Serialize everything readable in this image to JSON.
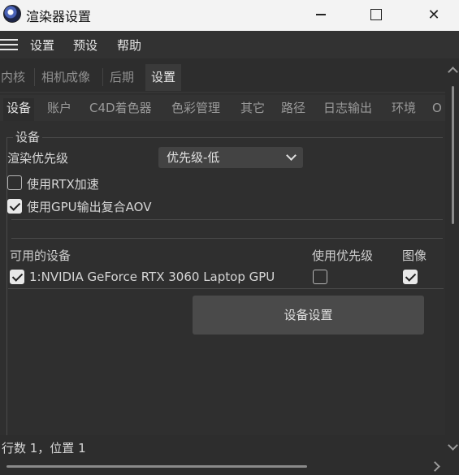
{
  "window": {
    "title": "渲染器设置"
  },
  "menu": {
    "items": [
      "设置",
      "预设",
      "帮助"
    ]
  },
  "top_tabs": [
    "内核",
    "相机成像",
    "后期",
    "设置"
  ],
  "sub_tabs": [
    "设备",
    "账户",
    "C4D着色器",
    "色彩管理",
    "其它",
    "路径",
    "日志输出",
    "环境",
    "O"
  ],
  "device_group": {
    "title": "设备",
    "priority_label": "渲染优先级",
    "priority_value": "优先级-低",
    "rtx_label": "使用RTX加速",
    "rtx_checked": false,
    "gpu_aov_label": "使用GPU输出复合AOV",
    "gpu_aov_checked": true
  },
  "device_table": {
    "headers": [
      "可用的设备",
      "使用优先级",
      "图像"
    ],
    "rows": [
      {
        "name": "1:NVIDIA GeForce RTX 3060 Laptop GPU",
        "enabled": true,
        "priority": false,
        "image": true
      }
    ]
  },
  "device_settings_button": "设备设置",
  "status": {
    "text": "行数 1，位置 1"
  },
  "colors": {
    "background": "#2d2d2d",
    "panel": "#2f2f2f",
    "titlebar": "#f3f3f3",
    "button": "#4a4a4a"
  }
}
